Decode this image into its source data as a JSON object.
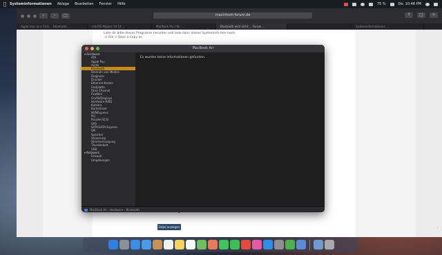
{
  "menubar": {
    "apple": "",
    "items": [
      "Systeminformationen",
      "Ablage",
      "Bearbeiten",
      "Fenster",
      "Hilfe"
    ],
    "right_text": [
      "75 %",
      "Do. 10:48 PM"
    ]
  },
  "browser": {
    "url": "macintosh-forum.de",
    "tabs": [
      "Apple mac os x 10.6 ... Bluetooth ...",
      "macOS Mojave 10.14 ...",
      "MacBook Pro / Air ...",
      "Bluetooth wird nicht ... Forum ...",
      "",
      "Systeminformationen ..."
    ],
    "page_text": [
      "Liste dir bitte dieses Programm herunter und lade dann dieses Systeminfo hier hoch.",
      "-> File > Save a Copy as"
    ],
    "page_button": "Datei anzeigen"
  },
  "window": {
    "title": "MacBook Air",
    "message": "Es wurden keine Informationen gefunden.",
    "sidebar": [
      {
        "label": "Hardware",
        "section": true
      },
      {
        "label": "ATA"
      },
      {
        "label": "Apple Pay"
      },
      {
        "label": "Audio"
      },
      {
        "label": "Bluetooth",
        "selected": true
      },
      {
        "label": "Brennen von Medien"
      },
      {
        "label": "Diagnose"
      },
      {
        "label": "Drucker"
      },
      {
        "label": "Ethernet-Karten"
      },
      {
        "label": "Festplatte"
      },
      {
        "label": "Fibre Channel"
      },
      {
        "label": "FireWire"
      },
      {
        "label": "Grafik/Displays"
      },
      {
        "label": "Hardware-RAID"
      },
      {
        "label": "Kamera"
      },
      {
        "label": "Kartenleser"
      },
      {
        "label": "NVMExpress"
      },
      {
        "label": "PCI"
      },
      {
        "label": "Parallel-SCSI"
      },
      {
        "label": "SAS"
      },
      {
        "label": "SATA/SATA Express"
      },
      {
        "label": "SPI"
      },
      {
        "label": "Speicher"
      },
      {
        "label": "Steuerung"
      },
      {
        "label": "Stromversorgung"
      },
      {
        "label": "Thunderbolt"
      },
      {
        "label": "USB"
      },
      {
        "label": "Netzwerk",
        "section": true
      },
      {
        "label": "Firewall"
      },
      {
        "label": "Umgebungen"
      }
    ],
    "path": [
      "MacBook Air",
      "Hardware",
      "Bluetooth"
    ]
  },
  "dock": {
    "icons": [
      {
        "name": "finder-icon",
        "color": "#2f7fe0"
      },
      {
        "name": "launchpad-icon",
        "color": "#8a8f99"
      },
      {
        "name": "safari-icon",
        "color": "#3a8de6"
      },
      {
        "name": "mail-icon",
        "color": "#4b9be8"
      },
      {
        "name": "contacts-icon",
        "color": "#c7925a"
      },
      {
        "name": "calendar-icon",
        "color": "#f0f0f0"
      },
      {
        "name": "notes-icon",
        "color": "#f4d35e"
      },
      {
        "name": "reminders-icon",
        "color": "#f7f7f7"
      },
      {
        "name": "maps-icon",
        "color": "#6fbf5f"
      },
      {
        "name": "photos-icon",
        "color": "#e77a5b"
      },
      {
        "name": "messages-icon",
        "color": "#3fc35a"
      },
      {
        "name": "facetime-icon",
        "color": "#3cbf56"
      },
      {
        "name": "news-icon",
        "color": "#e8493f"
      },
      {
        "name": "itunes-icon",
        "color": "#e35aa9"
      },
      {
        "name": "appstore-icon",
        "color": "#2f8fe8"
      },
      {
        "name": "system-preferences-icon",
        "color": "#8e8e93"
      },
      {
        "name": "chrome-icon",
        "color": "#4caf50"
      },
      {
        "name": "system-information-icon",
        "color": "#5c8bd6"
      },
      {
        "name": "folder-icon",
        "color": "#6f9bd1"
      },
      {
        "name": "trash-icon",
        "color": "#a7a9ad"
      }
    ]
  }
}
